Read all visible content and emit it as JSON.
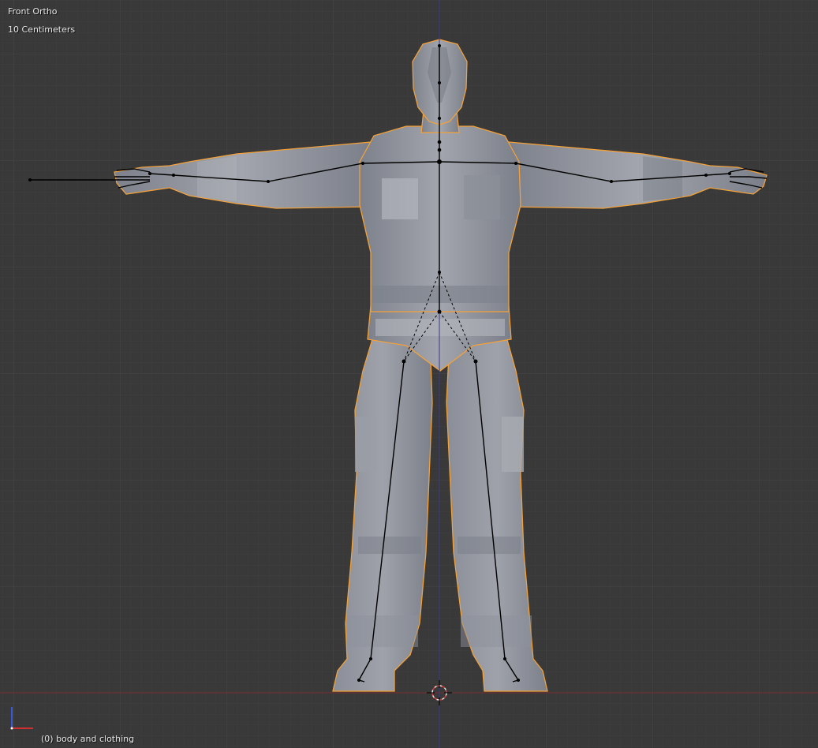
{
  "viewport": {
    "view_name": "Front Ortho",
    "grid_scale": "10 Centimeters",
    "object_info": "(0) body and clothing"
  },
  "icons": [
    "axis-gizmo-icon",
    "3d-cursor-icon"
  ],
  "colors": {
    "background": "#393939",
    "grid_minor": "#404040",
    "grid_major": "#464646",
    "x_axis": "#7a2e2e",
    "z_axis": "#3a3a86",
    "mesh": "#8e929c",
    "selection_outline": "#f2a13a",
    "bones": "#000000"
  }
}
